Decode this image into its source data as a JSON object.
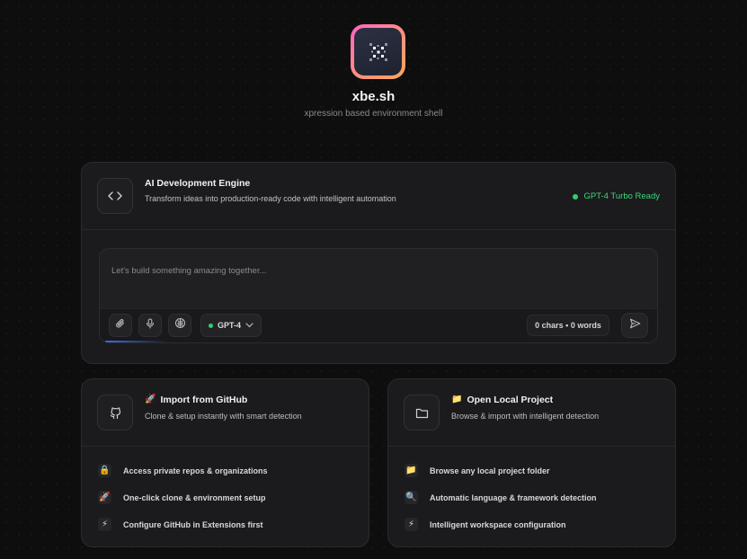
{
  "header": {
    "app_name": "xbe.sh",
    "tagline": "xpression based environment shell"
  },
  "engine": {
    "title": "AI Development Engine",
    "subtitle": "Transform ideas into production-ready code with intelligent automation",
    "status": "GPT-4 Turbo Ready",
    "status_color": "#3dd67a"
  },
  "composer": {
    "placeholder": "Let's build something amazing together...",
    "value": "",
    "model_label": "GPT-4",
    "counter": "0 chars • 0 words",
    "icons": [
      "paperclip-icon",
      "microphone-icon",
      "brain-icon",
      "chevron-down-icon",
      "send-icon"
    ]
  },
  "cards": [
    {
      "title": "Import from GitHub",
      "title_emoji": "🚀",
      "subtitle": "Clone & setup instantly with smart detection",
      "icon": "github-icon",
      "features": [
        {
          "icon": "lock-icon",
          "emoji": "🔒",
          "label": "Access private repos & organizations"
        },
        {
          "icon": "rocket-icon",
          "emoji": "🚀",
          "label": "One-click clone & environment setup"
        },
        {
          "icon": "lightning-icon",
          "emoji": "⚡",
          "label": "Configure GitHub in Extensions first"
        }
      ]
    },
    {
      "title": "Open Local Project",
      "title_emoji": "📁",
      "subtitle": "Browse & import with intelligent detection",
      "icon": "folder-icon",
      "features": [
        {
          "icon": "folder-icon",
          "emoji": "📁",
          "label": "Browse any local project folder"
        },
        {
          "icon": "magnifier-icon",
          "emoji": "🔍",
          "label": "Automatic language & framework detection"
        },
        {
          "icon": "lightning-icon",
          "emoji": "⚡",
          "label": "Intelligent workspace configuration"
        }
      ]
    }
  ],
  "colors": {
    "background": "#0e0e0f",
    "panel": "#1b1b1d",
    "accent_green": "#2fd06f",
    "logo_gradient": [
      "#ff63c5",
      "#ffa657"
    ]
  }
}
